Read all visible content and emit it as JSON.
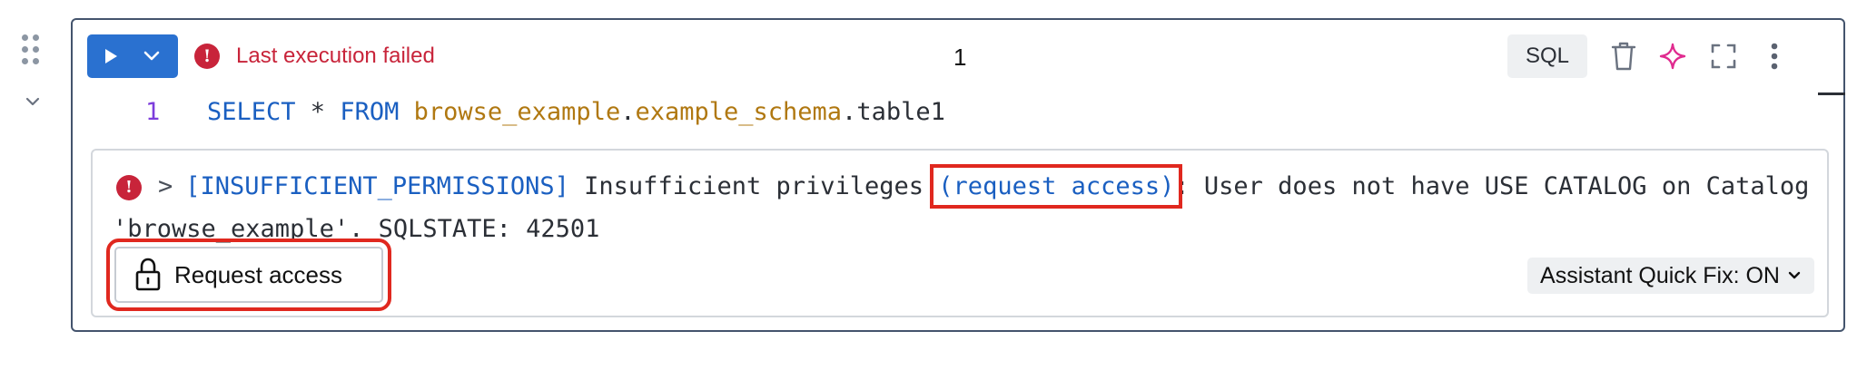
{
  "cell": {
    "run_label": "Run cell",
    "status_text": "Last execution failed",
    "cell_number": "1",
    "language": "SQL",
    "toolbar_icons": [
      "trash-icon",
      "sparkle-icon",
      "expand-icon",
      "more-vertical-icon"
    ],
    "code": {
      "line_number": "1",
      "tokens": {
        "select": "SELECT",
        "star": " * ",
        "from": "FROM",
        "catalog": "browse_example",
        "dot1": ".",
        "schema": "example_schema",
        "dot2": ".",
        "table": "table1"
      }
    }
  },
  "output": {
    "error_code": "[INSUFFICIENT_PERMISSIONS]",
    "message_pre": " Insufficient privileges ",
    "request_link": "(request access)",
    "message_post": ": User does not have USE CATALOG on Catalog 'browse_example'. SQLSTATE: 42501",
    "request_button": "Request access",
    "quick_fix": "Assistant Quick Fix: ON"
  },
  "colors": {
    "accent": "#2a71d0",
    "error": "#c8243a",
    "highlight_box": "#e0281f",
    "keyword": "#1a5fc1",
    "identifier": "#b07811",
    "line_number": "#7d3ddc"
  }
}
